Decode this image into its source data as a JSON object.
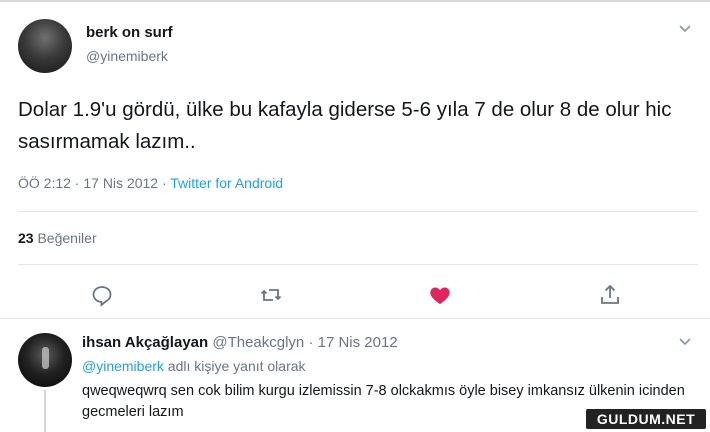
{
  "tweet": {
    "display_name": "berk on surf",
    "handle": "@yinemiberk",
    "text": "Dolar 1.9'u gördü, ülke bu kafayla giderse 5-6 yıla 7 de olur 8 de olur hic sasırmamak lazım..",
    "time": "ÖÖ 2:12 · 17 Nis 2012 · ",
    "source": "Twitter for Android",
    "likes_count": "23",
    "likes_label": "Beğeniler",
    "actions": [
      {
        "icon": "reply-icon"
      },
      {
        "icon": "retweet-icon"
      },
      {
        "icon": "like-icon",
        "active": true,
        "color": "#e0245e"
      },
      {
        "icon": "share-icon"
      }
    ]
  },
  "reply": {
    "display_name": "ihsan Akçağlayan",
    "handle": "@Theakcglyn",
    "date": "17 Nis 2012",
    "separator": " · ",
    "replying_mention": "@yinemiberk",
    "replying_suffix": " adlı kişiye yanıt olarak",
    "text": "qweqweqwrq sen cok bilim kurgu izlemissin 7-8 olckakmıs öyle bisey imkansız ülkenin icinden gecmeleri lazım"
  },
  "watermark": "GULDUM.NET",
  "colors": {
    "link": "#1da1f2",
    "secondary_text": "#657786",
    "like_active": "#e0245e"
  }
}
